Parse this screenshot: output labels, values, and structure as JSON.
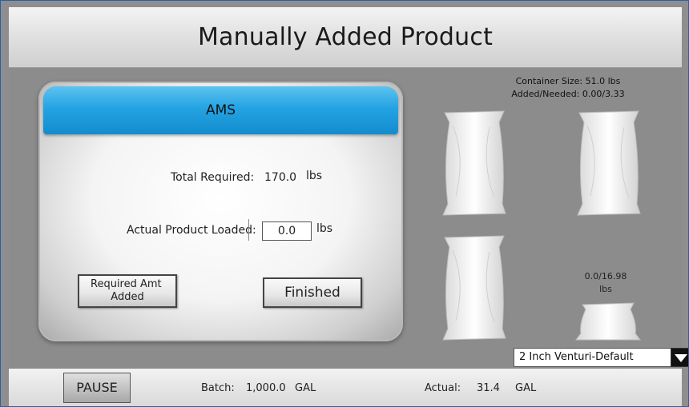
{
  "header": {
    "title": "Manually Added Product"
  },
  "dialog": {
    "title": "AMS",
    "total_required_label": "Total Required:",
    "total_required_value": "170.0",
    "total_required_unit": "lbs",
    "actual_loaded_label": "Actual Product Loaded:",
    "actual_loaded_value": "0.0",
    "actual_loaded_unit": "lbs",
    "required_amt_button_line1": "Required Amt",
    "required_amt_button_line2": "Added",
    "finished_button": "Finished"
  },
  "container": {
    "size_label": "Container Size: 51.0 lbs",
    "added_needed_label": "Added/Needed: 0.00/3.33"
  },
  "partial_bag": {
    "value": "0.0/16.98",
    "unit": "lbs"
  },
  "venturi_select": {
    "selected": "2 Inch Venturi-Default"
  },
  "footer": {
    "pause_label": "PAUSE",
    "batch_label": "Batch:",
    "batch_value": "1,000.0",
    "batch_unit": "GAL",
    "actual_label": "Actual:",
    "actual_value": "31.4",
    "actual_unit": "GAL"
  },
  "icons": {
    "bag": "product-bag-icon",
    "dropdown": "triangle-down-icon"
  },
  "colors": {
    "dialog_header": "#24a3e3",
    "background": "#8c8c8c"
  }
}
